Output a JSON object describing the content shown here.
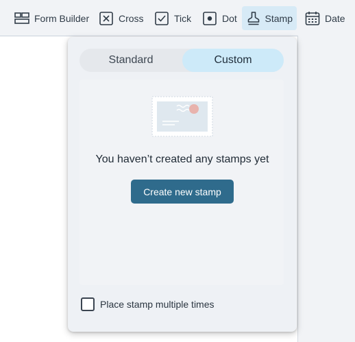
{
  "toolbar": {
    "items": [
      {
        "label": "Form Builder",
        "icon": "form-builder-icon"
      },
      {
        "label": "Cross",
        "icon": "cross-box-icon"
      },
      {
        "label": "Tick",
        "icon": "tick-box-icon"
      },
      {
        "label": "Dot",
        "icon": "dot-box-icon"
      },
      {
        "label": "Stamp",
        "icon": "stamp-icon",
        "active": true
      },
      {
        "label": "Date",
        "icon": "calendar-icon"
      }
    ]
  },
  "stamp_popover": {
    "tabs": [
      {
        "label": "Standard",
        "selected": false
      },
      {
        "label": "Custom",
        "selected": true
      }
    ],
    "empty_message": "You haven’t created any stamps yet",
    "create_button": "Create new stamp",
    "multiple_checkbox": {
      "label": "Place stamp multiple times",
      "checked": false
    }
  },
  "colors": {
    "accent": "#2f6b8c",
    "active_tab": "#cdeaf9",
    "active_tool": "#d7eaf6"
  }
}
